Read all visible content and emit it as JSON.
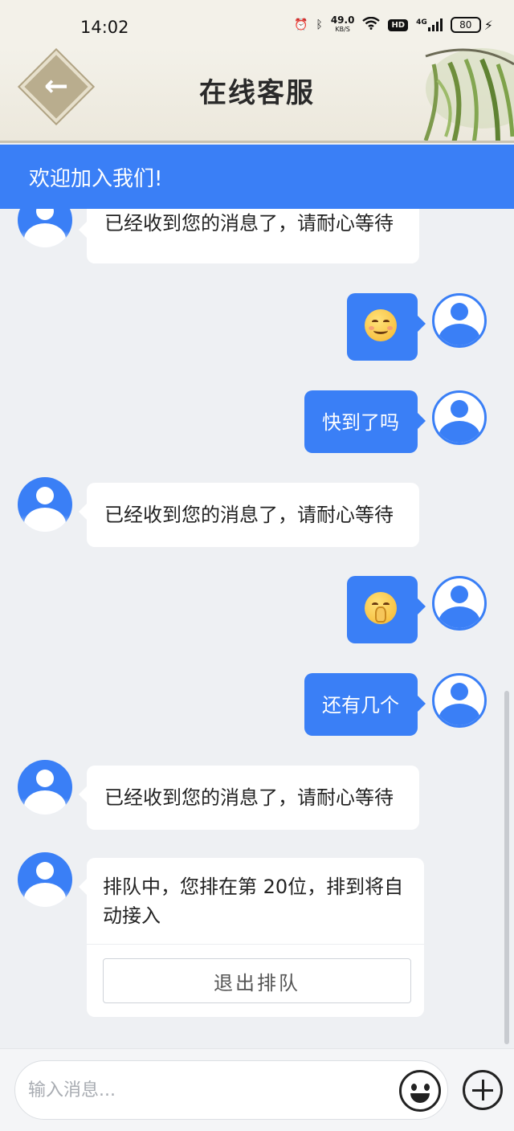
{
  "status_bar": {
    "time": "14:02",
    "net_speed": "49.0",
    "net_unit": "KB/S",
    "hd_label": "HD",
    "signal_label": "4G",
    "battery": "80",
    "icons": [
      "alarm-icon",
      "bluetooth-icon",
      "wifi-icon",
      "signal-icon",
      "battery-icon",
      "charging-icon"
    ]
  },
  "header": {
    "title": "在线客服",
    "back_icon": "arrow-left-icon"
  },
  "banner": {
    "text": "欢迎加入我们!"
  },
  "messages": [
    {
      "from": "agent",
      "text": "已经收到您的消息了，请耐心等待"
    },
    {
      "from": "user",
      "emoji": "smiling-face-emoji"
    },
    {
      "from": "user",
      "text": "快到了吗"
    },
    {
      "from": "agent",
      "text": "已经收到您的消息了，请耐心等待"
    },
    {
      "from": "user",
      "emoji": "shushing-face-emoji"
    },
    {
      "from": "user",
      "text": "还有几个"
    },
    {
      "from": "agent",
      "text": "已经收到您的消息了，请耐心等待"
    },
    {
      "from": "agent",
      "text": "排队中，您排在第 20位，排到将自动接入",
      "button": "退出排队"
    }
  ],
  "input": {
    "placeholder": "输入消息...",
    "emoji_icon": "smiley-icon",
    "add_icon": "plus-circle-icon"
  },
  "colors": {
    "accent": "#3a7ff6",
    "bubble_in": "#ffffff",
    "background": "#eef0f3"
  }
}
